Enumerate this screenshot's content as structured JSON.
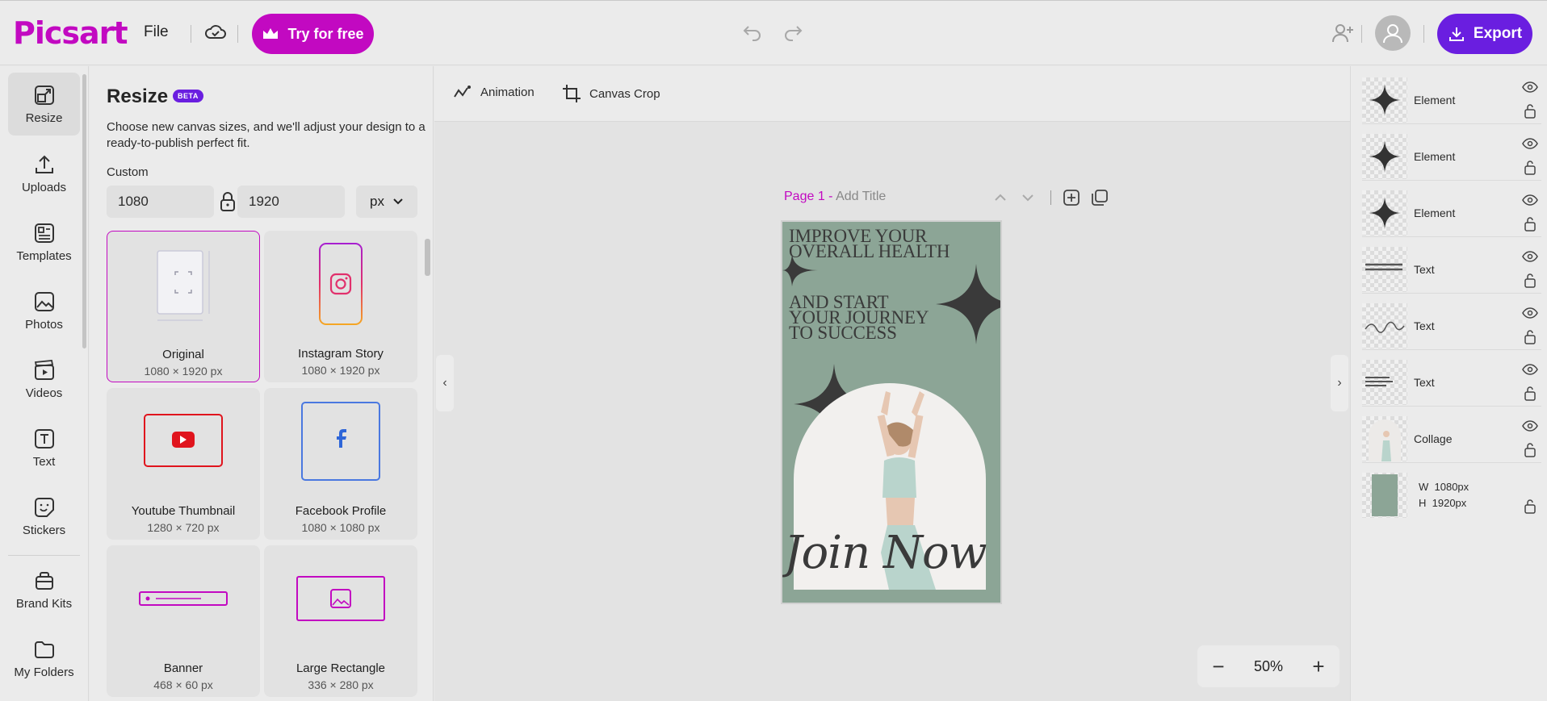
{
  "app": {
    "logo": "Picsart",
    "file_menu": "File",
    "try_label": "Try for free",
    "export_label": "Export"
  },
  "nav": {
    "items": [
      {
        "label": "Resize",
        "icon": "resize-icon"
      },
      {
        "label": "Uploads",
        "icon": "upload-icon"
      },
      {
        "label": "Templates",
        "icon": "templates-icon"
      },
      {
        "label": "Photos",
        "icon": "photos-icon"
      },
      {
        "label": "Videos",
        "icon": "videos-icon"
      },
      {
        "label": "Text",
        "icon": "text-icon"
      },
      {
        "label": "Stickers",
        "icon": "stickers-icon"
      },
      {
        "label": "Brand Kits",
        "icon": "brand-kits-icon"
      },
      {
        "label": "My Folders",
        "icon": "folders-icon"
      }
    ]
  },
  "resize": {
    "title": "Resize",
    "badge": "BETA",
    "description": "Choose new canvas sizes, and we'll adjust your design to a ready-to-publish perfect fit.",
    "custom_label": "Custom",
    "width": "1080",
    "height": "1920",
    "unit": "px",
    "presets": [
      {
        "name": "Original",
        "size": "1080 × 1920 px"
      },
      {
        "name": "Instagram Story",
        "size": "1080 × 1920 px"
      },
      {
        "name": "Youtube Thumbnail",
        "size": "1280 × 720 px"
      },
      {
        "name": "Facebook Profile",
        "size": "1080 × 1080 px"
      },
      {
        "name": "Banner",
        "size": "468 × 60 px"
      },
      {
        "name": "Large Rectangle",
        "size": "336 × 280 px"
      }
    ]
  },
  "toolbar": {
    "animation": "Animation",
    "canvas_crop": "Canvas Crop"
  },
  "page": {
    "number": "Page 1",
    "separator": " - ",
    "title_placeholder": "Add Title"
  },
  "poster": {
    "lines": [
      "IMPROVE YOUR",
      "OVERALL HEALTH",
      "AND START",
      "YOUR JOURNEY",
      "TO SUCCESS"
    ],
    "script": "Join Now",
    "background": "#8ca596"
  },
  "zoom": {
    "value": "50%"
  },
  "layers": {
    "items": [
      {
        "name": "Element"
      },
      {
        "name": "Element"
      },
      {
        "name": "Element"
      },
      {
        "name": "Text"
      },
      {
        "name": "Text"
      },
      {
        "name": "Text"
      },
      {
        "name": "Collage"
      }
    ],
    "background": {
      "w_label": "W",
      "w_value": "1080px",
      "h_label": "H",
      "h_value": "1920px"
    }
  },
  "colors": {
    "brand": "#c209c1",
    "export": "#6a1ee0",
    "poster_bg": "#8ca596"
  }
}
